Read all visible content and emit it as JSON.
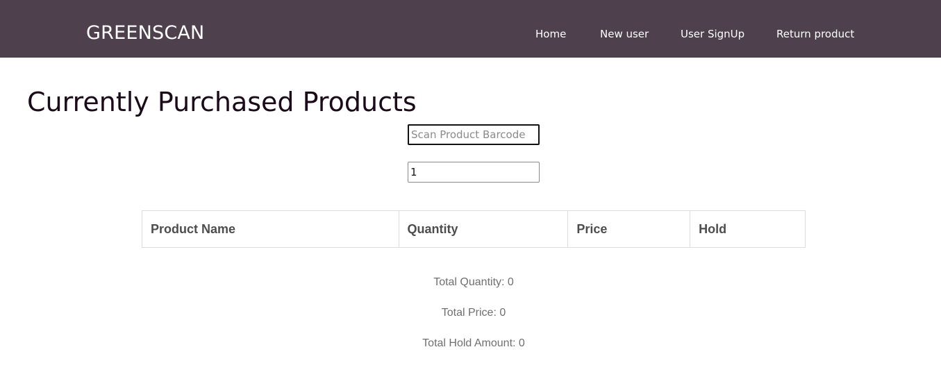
{
  "header": {
    "brand": "GREENSCAN",
    "nav": [
      {
        "label": "Home"
      },
      {
        "label": "New user"
      },
      {
        "label": "User SignUp"
      },
      {
        "label": "Return product"
      }
    ]
  },
  "main": {
    "title": "Currently Purchased Products",
    "barcode_input": {
      "placeholder": "Scan Product Barcode",
      "value": ""
    },
    "quantity_input": {
      "value": "1"
    },
    "table": {
      "columns": [
        "Product Name",
        "Quantity",
        "Price",
        "Hold"
      ],
      "rows": []
    },
    "summary": {
      "total_quantity": "Total Quantity: 0",
      "total_price": "Total Price: 0",
      "total_hold": "Total Hold Amount: 0"
    }
  },
  "colors": {
    "navbar_bg": "#4e414d",
    "title_text": "#1b0b1a",
    "summary_text": "#6f6f6f"
  }
}
